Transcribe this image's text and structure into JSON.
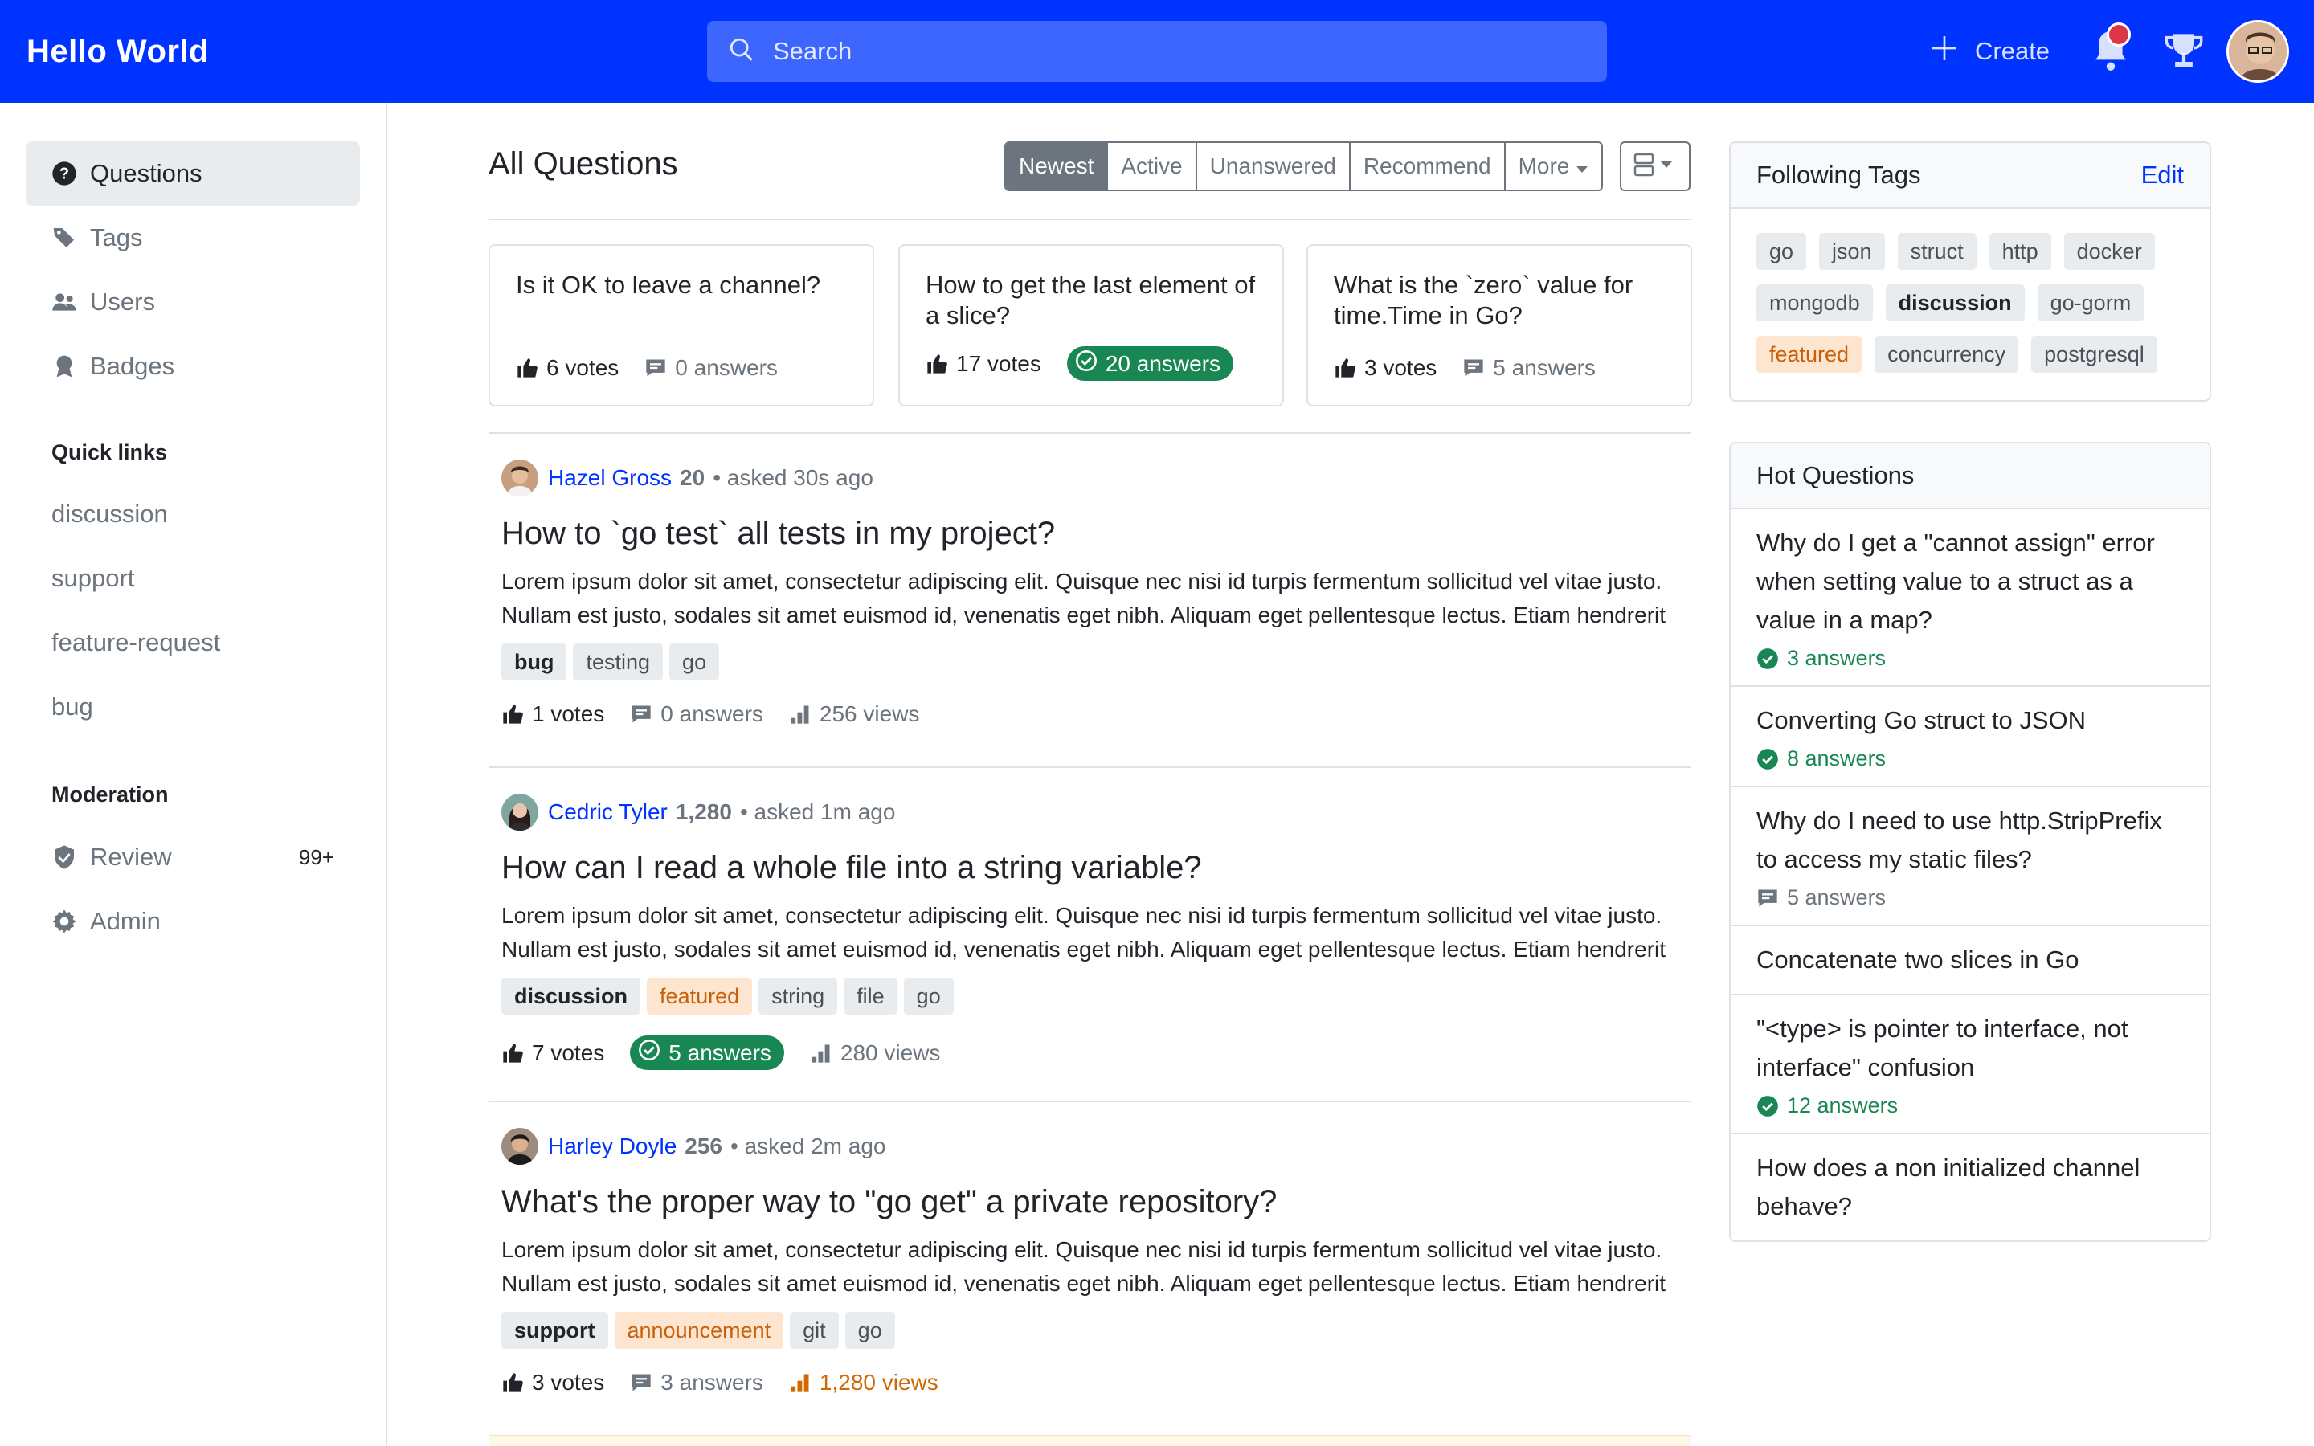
{
  "header": {
    "brand": "Hello World",
    "search_placeholder": "Search",
    "create_label": "Create",
    "accent_color": "#0033ff"
  },
  "sidebar": {
    "items": [
      {
        "label": "Questions",
        "icon": "question-circle-icon"
      },
      {
        "label": "Tags",
        "icon": "tags-icon"
      },
      {
        "label": "Users",
        "icon": "people-icon"
      },
      {
        "label": "Badges",
        "icon": "award-icon"
      }
    ],
    "quick_links_heading": "Quick links",
    "quick_links": [
      "discussion",
      "support",
      "feature-request",
      "bug"
    ],
    "moderation_heading": "Moderation",
    "moderation": [
      {
        "label": "Review",
        "icon": "shield-check-icon",
        "count": "99+"
      },
      {
        "label": "Admin",
        "icon": "gear-icon"
      }
    ]
  },
  "main": {
    "title": "All Questions",
    "filters": [
      "Newest",
      "Active",
      "Unanswered",
      "Recommend",
      "More"
    ],
    "active_filter": "Newest",
    "cards": [
      {
        "title": "Is it OK to leave a channel?",
        "votes": "6 votes",
        "answers": "0 answers",
        "accepted": false
      },
      {
        "title": "How to get the last element of a slice?",
        "votes": "17 votes",
        "answers": "20 answers",
        "accepted": true
      },
      {
        "title": "What is the `zero` value for time.Time in Go?",
        "votes": "3 votes",
        "answers": "5 answers",
        "accepted": false
      }
    ],
    "questions": [
      {
        "author": "Hazel Gross",
        "rep": "20",
        "time": "• asked 30s ago",
        "title": "How to `go test` all tests in my project?",
        "excerpt_1": "Lorem ipsum dolor sit amet, consectetur adipiscing elit. Quisque nec nisi id turpis fermentum sollicitud vel vitae justo.",
        "excerpt_2": "Nullam est justo, sodales sit amet euismod id, venenatis eget nibh. Aliquam eget pellentesque lectus. Etiam hendrerit",
        "tags": [
          "bug",
          "testing",
          "go"
        ],
        "votes": "1 votes",
        "answers": "0 answers",
        "views": "256 views"
      },
      {
        "author": "Cedric Tyler",
        "rep": "1,280",
        "time": "• asked 1m ago",
        "title": "How can I read a whole file into a string variable?",
        "excerpt_1": "Lorem ipsum dolor sit amet, consectetur adipiscing elit. Quisque nec nisi id turpis fermentum sollicitud vel vitae justo.",
        "excerpt_2": "Nullam est justo, sodales sit amet euismod id, venenatis eget nibh. Aliquam eget pellentesque lectus. Etiam hendrerit",
        "tags": [
          "discussion",
          "featured",
          "string",
          "file",
          "go"
        ],
        "votes": "7 votes",
        "answers": "5 answers",
        "views": "280 views"
      },
      {
        "author": "Harley Doyle",
        "rep": "256",
        "time": "• asked 2m ago",
        "title": "What's the proper way to \"go get\" a private repository?",
        "excerpt_1": "Lorem ipsum dolor sit amet, consectetur adipiscing elit. Quisque nec nisi id turpis fermentum sollicitud vel vitae justo.",
        "excerpt_2": "Nullam est justo, sodales sit amet euismod id, venenatis eget nibh. Aliquam eget pellentesque lectus. Etiam hendrerit",
        "tags": [
          "support",
          "announcement",
          "git",
          "go"
        ],
        "votes": "3 votes",
        "answers": "3 answers",
        "views": "1,280 views"
      }
    ]
  },
  "following_tags": {
    "title": "Following Tags",
    "edit_label": "Edit",
    "tags": [
      "go",
      "json",
      "struct",
      "http",
      "docker",
      "mongodb",
      "discussion",
      "go-gorm",
      "featured",
      "concurrency",
      "postgresql"
    ]
  },
  "hot_questions": {
    "title": "Hot Questions",
    "items": [
      {
        "title": "Why do I get a \"cannot assign\" error when setting value to a struct as a value in a map?",
        "answers": "3 answers",
        "accepted": true
      },
      {
        "title": "Converting Go struct to JSON",
        "answers": "8 answers",
        "accepted": true
      },
      {
        "title": "Why do I need to use http.StripPrefix to access my static files?",
        "answers": "5 answers",
        "accepted": false
      },
      {
        "title": "Concatenate two slices in Go",
        "answers": "",
        "accepted": false
      },
      {
        "title": "\"<type> is pointer to interface, not interface\" confusion",
        "answers": "12 answers",
        "accepted": true
      },
      {
        "title": "How does a non initialized channel behave?",
        "answers": "",
        "accepted": false
      }
    ]
  }
}
